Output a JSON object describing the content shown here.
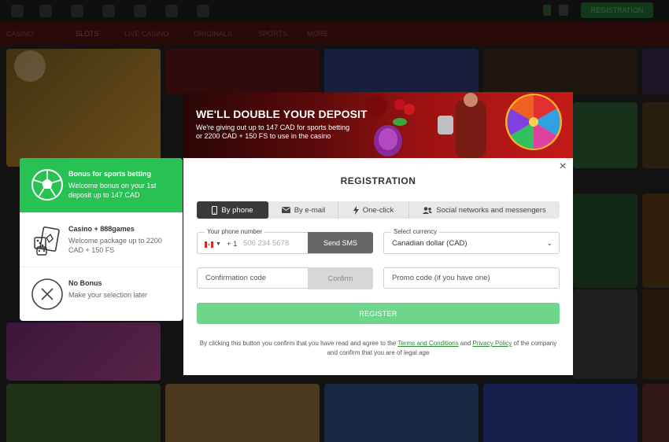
{
  "background": {
    "header_register_label": "REGISTRATION",
    "nav": [
      "CASINO",
      "SLOTS",
      "LIVE CASINO",
      "ORIGINALS",
      "SPORTS",
      "MORE"
    ]
  },
  "bonus_panel": {
    "items": [
      {
        "icon": "soccer-ball-icon",
        "title": "Bonus for sports betting",
        "desc": "Welcome bonus on your 1st deposit up to 147 CAD"
      },
      {
        "icon": "cards-dice-icon",
        "title": "Casino + 888games",
        "desc": "Welcome package up to 2200 CAD + 150 FS"
      },
      {
        "icon": "no-bonus-icon",
        "title": "No Bonus",
        "desc": "Make your selection later"
      }
    ]
  },
  "banner": {
    "title": "WE'LL DOUBLE YOUR DEPOSIT",
    "line1": "We're giving out up to 147 CAD for sports betting",
    "line2": "or 2200 CAD + 150 FS to use in the casino"
  },
  "modal": {
    "title": "REGISTRATION",
    "close": "×",
    "tabs": [
      {
        "label": "By phone",
        "icon": "phone-icon"
      },
      {
        "label": "By e-mail",
        "icon": "envelope-icon"
      },
      {
        "label": "One-click",
        "icon": "lightning-icon"
      },
      {
        "label": "Social networks and messengers",
        "icon": "people-icon"
      }
    ],
    "phone": {
      "label": "Your phone number",
      "code": "+ 1",
      "placeholder": "506 234 5678",
      "send": "Send SMS"
    },
    "currency": {
      "label": "Select currency",
      "value": "Canadian dollar (CAD)"
    },
    "confirmation": {
      "placeholder": "Confirmation code",
      "button": "Confirm"
    },
    "promo": {
      "placeholder": "Promo code (if you have one)"
    },
    "register": "REGISTER",
    "legal": {
      "pre": "By clicking this button you confirm that you have read and agree to the ",
      "terms": "Terms and Conditions",
      "mid": " and ",
      "privacy": "Privacy Policy",
      "post": " of the company and confirm that you are of legal age"
    }
  },
  "colors": {
    "accent_green": "#27c154",
    "register_green": "#6ed68b",
    "dark_tab": "#3a3a3a"
  }
}
